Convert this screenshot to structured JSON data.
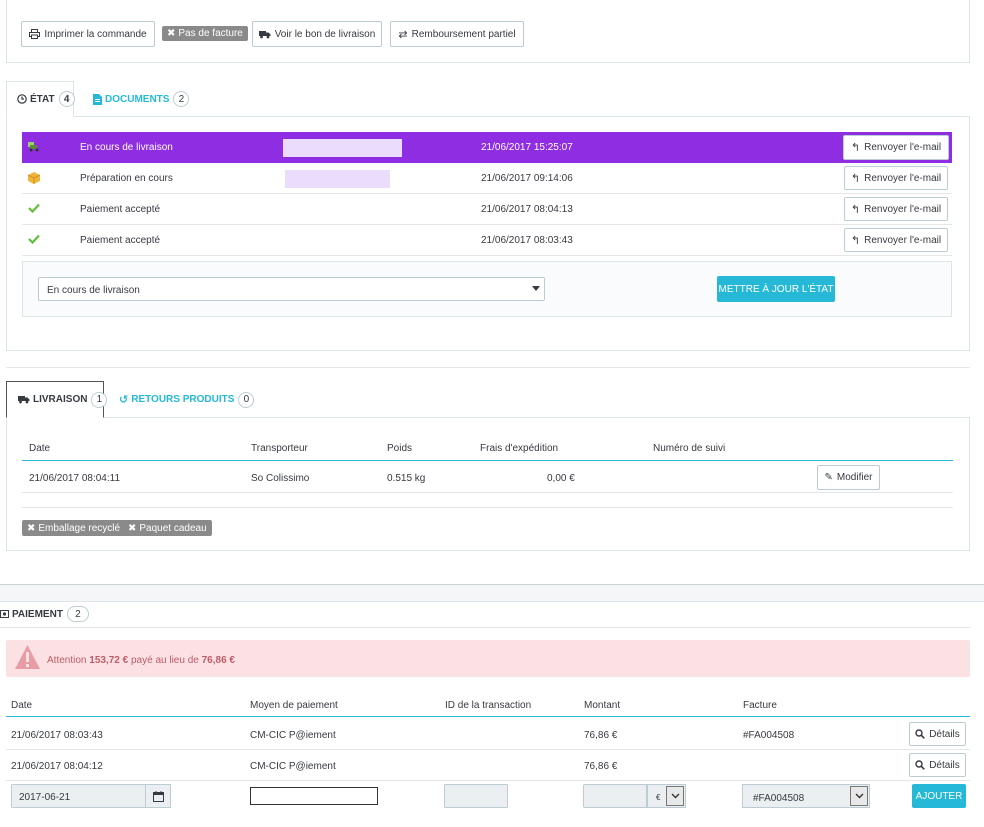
{
  "toolbar": {
    "print_label": "Imprimer la commande",
    "no_invoice_label": "Pas de facture",
    "delivery_slip_label": "Voir le bon de livraison",
    "partial_refund_label": "Remboursement partiel"
  },
  "status_tabs": {
    "state_label": "ÉTAT",
    "state_count": "4",
    "documents_label": "DOCUMENTS",
    "documents_count": "2"
  },
  "history": [
    {
      "state": "En cours de livraison",
      "date": "21/06/2017 15:25:07",
      "action": "Renvoyer l'e-mail",
      "icon": "truck-icon"
    },
    {
      "state": "Préparation en cours",
      "date": "21/06/2017 09:14:06",
      "action": "Renvoyer l'e-mail",
      "icon": "box-icon"
    },
    {
      "state": "Paiement accepté",
      "date": "21/06/2017 08:04:13",
      "action": "Renvoyer l'e-mail",
      "icon": "check-icon"
    },
    {
      "state": "Paiement accepté",
      "date": "21/06/2017 08:03:43",
      "action": "Renvoyer l'e-mail",
      "icon": "check-icon"
    }
  ],
  "state_select": {
    "value": "En cours de livraison",
    "update_label": "METTRE À JOUR L'ÉTAT"
  },
  "shipping_tabs": {
    "delivery_label": "LIVRAISON",
    "delivery_count": "1",
    "returns_label": "RETOURS PRODUITS",
    "returns_count": "0"
  },
  "shipping": {
    "headers": [
      "Date",
      "Transporteur",
      "Poids",
      "Frais d'expédition",
      "Numéro de suivi"
    ],
    "row": {
      "date": "21/06/2017 08:04:11",
      "carrier": "So Colissimo",
      "weight": "0.515 kg",
      "cost": "0,00 €",
      "tracking": "",
      "edit_label": "Modifier"
    },
    "recycled_label": "Emballage recyclé",
    "gift_label": "Paquet cadeau"
  },
  "payment": {
    "title": "PAIEMENT",
    "count": "2",
    "alert_prefix": "Attention",
    "alert_paid": "153,72 €",
    "alert_middle": "payé au lieu de",
    "alert_expected": "76,86 €",
    "headers": [
      "Date",
      "Moyen de paiement",
      "ID de la transaction",
      "Montant",
      "Facture"
    ],
    "rows": [
      {
        "date": "21/06/2017 08:03:43",
        "method": "CM-CIC P@iement",
        "transaction": "",
        "amount": "76,86 €",
        "invoice": "#FA004508",
        "details_label": "Détails"
      },
      {
        "date": "21/06/2017 08:04:12",
        "method": "CM-CIC P@iement",
        "transaction": "",
        "amount": "76,86 €",
        "invoice": "",
        "details_label": "Détails"
      }
    ],
    "form": {
      "date_value": "2017-06-21",
      "method_value": "",
      "transaction_value": "",
      "amount_value": "",
      "currency": "€",
      "invoice_value": "#FA004508",
      "add_label": "AJOUTER"
    }
  },
  "colors": {
    "accent": "#25b9d7",
    "active_state": "#8e2de2",
    "alert_bg": "#fbe1e3",
    "alert_text": "#c05c67"
  }
}
